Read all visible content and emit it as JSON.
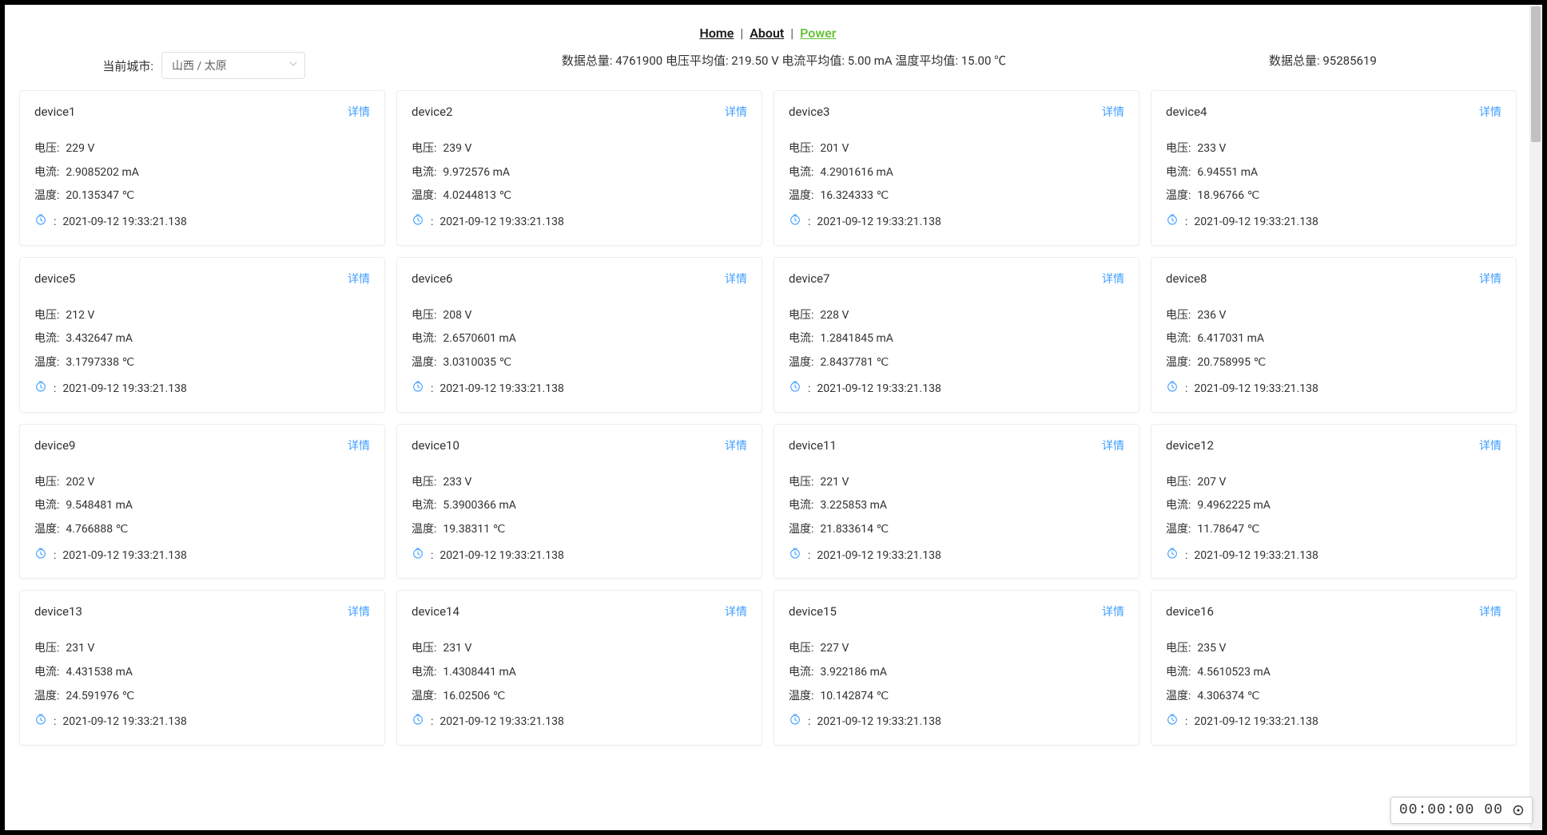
{
  "nav": {
    "home": "Home",
    "about": "About",
    "power": "Power"
  },
  "city": {
    "label": "当前城市:",
    "value": "山西 / 太原"
  },
  "summary_mid": "数据总量:  4761900 电压平均值:  219.50 V 电流平均值:  5.00 mA 温度平均值:  15.00 ℃",
  "summary_right": "数据总量:  95285619",
  "labels": {
    "voltage": "电压:",
    "current": "电流:",
    "temperature": "温度:",
    "detail": "详情"
  },
  "devices": [
    {
      "name": "device1",
      "voltage": "229 V",
      "current": "2.9085202 mA",
      "temp": "20.135347 ℃",
      "time": "2021-09-12 19:33:21.138"
    },
    {
      "name": "device2",
      "voltage": "239 V",
      "current": "9.972576 mA",
      "temp": "4.0244813 ℃",
      "time": "2021-09-12 19:33:21.138"
    },
    {
      "name": "device3",
      "voltage": "201 V",
      "current": "4.2901616 mA",
      "temp": "16.324333 ℃",
      "time": "2021-09-12 19:33:21.138"
    },
    {
      "name": "device4",
      "voltage": "233 V",
      "current": "6.94551 mA",
      "temp": "18.96766 ℃",
      "time": "2021-09-12 19:33:21.138"
    },
    {
      "name": "device5",
      "voltage": "212 V",
      "current": "3.432647 mA",
      "temp": "3.1797338 ℃",
      "time": "2021-09-12 19:33:21.138"
    },
    {
      "name": "device6",
      "voltage": "208 V",
      "current": "2.6570601 mA",
      "temp": "3.0310035 ℃",
      "time": "2021-09-12 19:33:21.138"
    },
    {
      "name": "device7",
      "voltage": "228 V",
      "current": "1.2841845 mA",
      "temp": "2.8437781 ℃",
      "time": "2021-09-12 19:33:21.138"
    },
    {
      "name": "device8",
      "voltage": "236 V",
      "current": "6.417031 mA",
      "temp": "20.758995 ℃",
      "time": "2021-09-12 19:33:21.138"
    },
    {
      "name": "device9",
      "voltage": "202 V",
      "current": "9.548481 mA",
      "temp": "4.766888 ℃",
      "time": "2021-09-12 19:33:21.138"
    },
    {
      "name": "device10",
      "voltage": "233 V",
      "current": "5.3900366 mA",
      "temp": "19.38311 ℃",
      "time": "2021-09-12 19:33:21.138"
    },
    {
      "name": "device11",
      "voltage": "221 V",
      "current": "3.225853 mA",
      "temp": "21.833614 ℃",
      "time": "2021-09-12 19:33:21.138"
    },
    {
      "name": "device12",
      "voltage": "207 V",
      "current": "9.4962225 mA",
      "temp": "11.78647 ℃",
      "time": "2021-09-12 19:33:21.138"
    },
    {
      "name": "device13",
      "voltage": "231 V",
      "current": "4.431538 mA",
      "temp": "24.591976 ℃",
      "time": "2021-09-12 19:33:21.138"
    },
    {
      "name": "device14",
      "voltage": "231 V",
      "current": "1.4308441 mA",
      "temp": "16.02506 ℃",
      "time": "2021-09-12 19:33:21.138"
    },
    {
      "name": "device15",
      "voltage": "227 V",
      "current": "3.922186 mA",
      "temp": "10.142874 ℃",
      "time": "2021-09-12 19:33:21.138"
    },
    {
      "name": "device16",
      "voltage": "235 V",
      "current": "4.5610523 mA",
      "temp": "4.306374 ℃",
      "time": "2021-09-12 19:33:21.138"
    }
  ],
  "status": {
    "time": "00:00:00",
    "frame": "00"
  }
}
